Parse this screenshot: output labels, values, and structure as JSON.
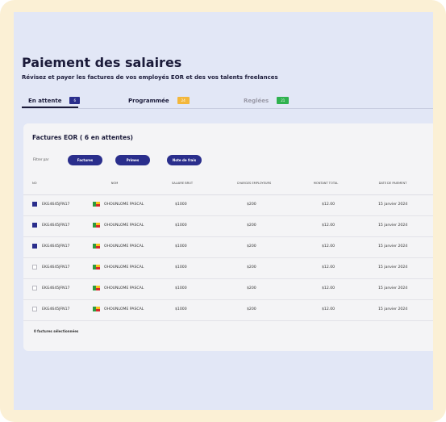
{
  "page": {
    "title": "Paiement des salaires",
    "subtitle": "Révisez et payer les factures de vos employés EOR et des vos talents freelances"
  },
  "tabs": [
    {
      "label": "En attente",
      "count": "6",
      "color": "#2a2e8c"
    },
    {
      "label": "Programmée",
      "count": "24",
      "color": "#f3b73b"
    },
    {
      "label": "Reglées",
      "count": "21",
      "color": "#2fb24f"
    }
  ],
  "card": {
    "title": "Factures  EOR ( 6 en attentes)",
    "filter_label": "Filtrer par",
    "filters": [
      "Factures",
      "Primes",
      "Note de frais"
    ],
    "columns": [
      "NO",
      "NOM",
      "SALAIRE BRUT",
      "CHARGES EMPLOYEURS",
      "MONTANT TOTAL",
      "DATE  DE PAIEMENT"
    ],
    "rows": [
      {
        "id": "EKG4645JFN17",
        "name": "OHOUNLOME PASCAL",
        "salary": "$1000",
        "charges": "$200",
        "total": "$12.00",
        "date": "15 janvier 2024",
        "checked": true
      },
      {
        "id": "EKG4645JFN17",
        "name": "OHOUNLOME PASCAL",
        "salary": "$1000",
        "charges": "$200",
        "total": "$12.00",
        "date": "15 janvier 2024",
        "checked": true
      },
      {
        "id": "EKG4645JFN17",
        "name": "OHOUNLOME PASCAL",
        "salary": "$1000",
        "charges": "$200",
        "total": "$12.00",
        "date": "15 janvier 2024",
        "checked": true
      },
      {
        "id": "EKG4645JFN17",
        "name": "OHOUNLOME PASCAL",
        "salary": "$1000",
        "charges": "$200",
        "total": "$12.00",
        "date": "15 janvier 2024",
        "checked": false
      },
      {
        "id": "EKG4645JFN17",
        "name": "OHOUNLOME PASCAL",
        "salary": "$1000",
        "charges": "$200",
        "total": "$12.00",
        "date": "15 janvier 2024",
        "checked": false
      },
      {
        "id": "EKG4645JFN17",
        "name": "OHOUNLOME PASCAL",
        "salary": "$1000",
        "charges": "$200",
        "total": "$12.00",
        "date": "15 janvier 2024",
        "checked": false
      }
    ],
    "footer": "0 factures sélectionnées"
  },
  "icons": {
    "country_flag": "benin-flag-icon"
  }
}
